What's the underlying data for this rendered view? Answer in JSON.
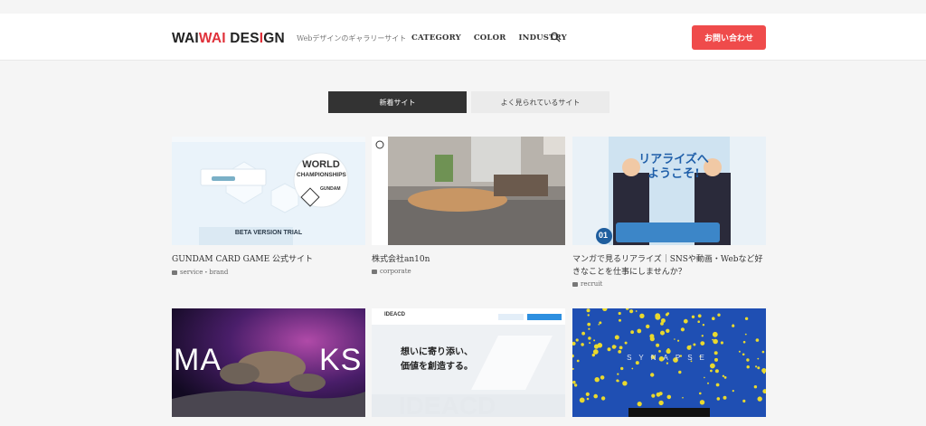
{
  "header": {
    "logo_a": "WAI",
    "logo_b": "WAI",
    "logo_c": "DES",
    "logo_d": "I",
    "logo_e": "GN",
    "tagline": "Webデザインのギャラリーサイト",
    "nav": [
      "CATEGORY",
      "COLOR",
      "INDUSTRY"
    ],
    "contact_label": "お問い合わせ"
  },
  "tabs": [
    "新着サイト",
    "よく見られているサイト"
  ],
  "cards": [
    {
      "title": "GUNDAM CARD GAME 公式サイト",
      "category": "service・brand",
      "thumb": "gundam",
      "thumb_text": [
        "WORLD",
        "CHAMPIONSHIPS",
        "GUNDAM",
        "BETA VERSION TRIAL"
      ]
    },
    {
      "title": "株式会社an10n",
      "category": "corporate",
      "thumb": "office",
      "thumb_text": []
    },
    {
      "title": "マンガで見るリアライズ｜SNSや動画・Webなど好きなことを仕事にしませんか？",
      "category": "recruit",
      "thumb": "manga",
      "thumb_text": [
        "リアライズへ",
        "ようこそ!",
        "01"
      ]
    },
    {
      "title": "",
      "category": "",
      "thumb": "wolves",
      "thumb_text": [
        "MA",
        "KS"
      ]
    },
    {
      "title": "",
      "category": "",
      "thumb": "ideacd",
      "thumb_text": [
        "IDEACD",
        "想いに寄り添い、",
        "価値を創造する。",
        "IDEACD"
      ]
    },
    {
      "title": "",
      "category": "",
      "thumb": "synapse",
      "thumb_text": [
        "SYNAPSE"
      ]
    }
  ]
}
